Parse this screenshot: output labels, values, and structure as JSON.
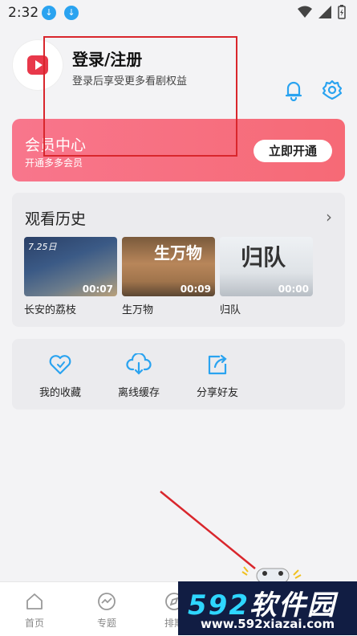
{
  "status": {
    "time": "2:32",
    "download_icon": "↓"
  },
  "profile": {
    "login_title": "登录/注册",
    "login_subtitle": "登录后享受更多看剧权益"
  },
  "vip": {
    "title": "会员中心",
    "subtitle": "开通多多会员",
    "button": "立即开通"
  },
  "history": {
    "title": "观看历史",
    "chevron": "›",
    "items": [
      {
        "name": "长安的荔枝",
        "duration": "00:07",
        "overlay": "7.25日"
      },
      {
        "name": "生万物",
        "duration": "00:09",
        "overlay": "生万物"
      },
      {
        "name": "归队",
        "duration": "00:00",
        "overlay": "归队"
      }
    ]
  },
  "actions": [
    {
      "label": "我的收藏",
      "icon": "heart-icon"
    },
    {
      "label": "离线缓存",
      "icon": "cloud-download-icon"
    },
    {
      "label": "分享好友",
      "icon": "share-icon"
    }
  ],
  "tabs": [
    {
      "label": "首页",
      "icon": "home-icon"
    },
    {
      "label": "专题",
      "icon": "trend-icon"
    },
    {
      "label": "排期",
      "icon": "compass-icon"
    }
  ],
  "watermark": {
    "brand_digits": "592",
    "brand_cn": "软件园",
    "url": "www.592xiazai.com"
  },
  "colors": {
    "accent": "#2aa3f0",
    "vip_gradient_start": "#f8768c",
    "vip_gradient_end": "#f66a76",
    "annotation_red": "#d9262c"
  }
}
